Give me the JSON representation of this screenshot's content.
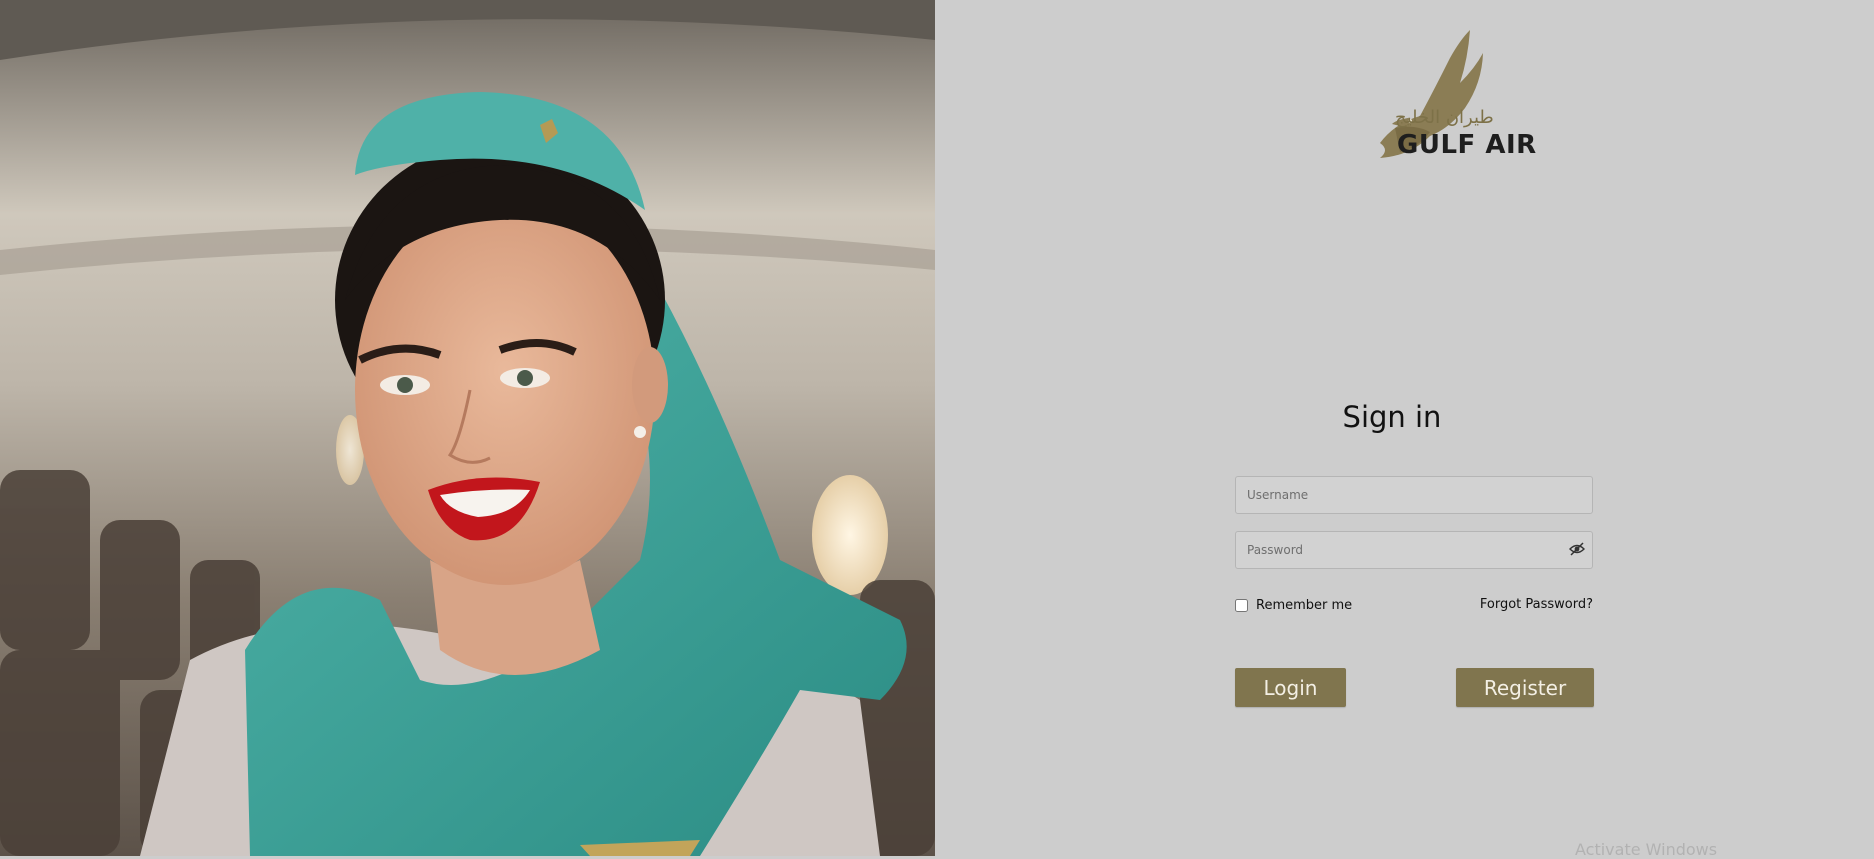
{
  "brand": {
    "arabic_name": "طيران الخليج",
    "name": "GULF AIR",
    "accent_color": "#80754e"
  },
  "hero": {
    "image": "flight-attendant-photo"
  },
  "form": {
    "title": "Sign in",
    "username_placeholder": "Username",
    "password_placeholder": "Password",
    "password_toggle_icon": "eye-slash-icon",
    "remember_label": "Remember me",
    "remember_checked": false,
    "forgot_label": "Forgot Password?",
    "login_label": "Login",
    "register_label": "Register"
  },
  "os_watermark": "Activate Windows"
}
